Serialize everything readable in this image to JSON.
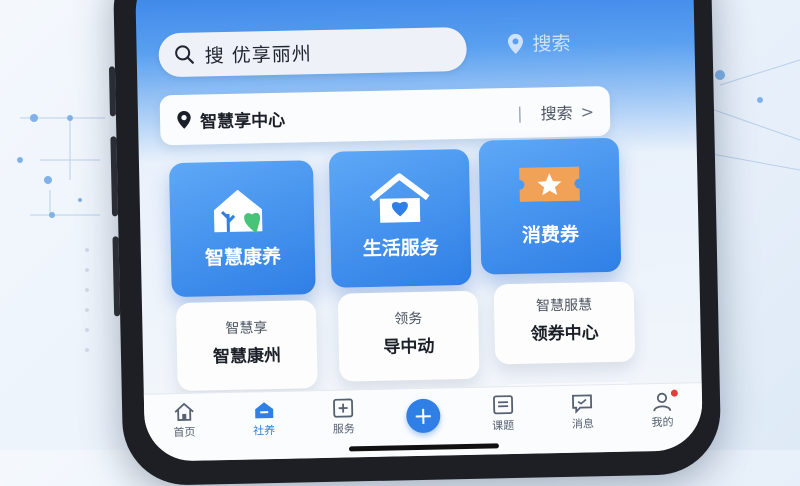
{
  "search": {
    "placeholder": "搜 优享丽州"
  },
  "top_right": {
    "label": "搜索",
    "icon": "location-pin-icon"
  },
  "center_bar": {
    "title": "智慧享中心",
    "separator": "|",
    "search_label": "搜索",
    "chevron": ">"
  },
  "tiles": [
    {
      "label": "智慧康养",
      "icon": "house-heart-icon"
    },
    {
      "label": "生活服务",
      "icon": "house-icon"
    },
    {
      "label": "消费券",
      "icon": "ticket-star-icon"
    }
  ],
  "cards": [
    {
      "sub": "智慧享",
      "main": "智慧康州"
    },
    {
      "sub": "领务",
      "main": "导中动"
    },
    {
      "sub": "智慧服慧",
      "main": "领券中心"
    }
  ],
  "nav": [
    {
      "label": "首页",
      "icon": "home-icon"
    },
    {
      "label": "社养",
      "icon": "care-icon",
      "active": true
    },
    {
      "label": "服务",
      "icon": "plus-box-icon"
    },
    {
      "label": "",
      "icon": "plus-icon"
    },
    {
      "label": "课题",
      "icon": "list-icon"
    },
    {
      "label": "消息",
      "icon": "message-icon"
    },
    {
      "label": "我的",
      "icon": "user-icon"
    }
  ],
  "colors": {
    "accent": "#2f7fe6",
    "badge": "#e63b3b"
  }
}
